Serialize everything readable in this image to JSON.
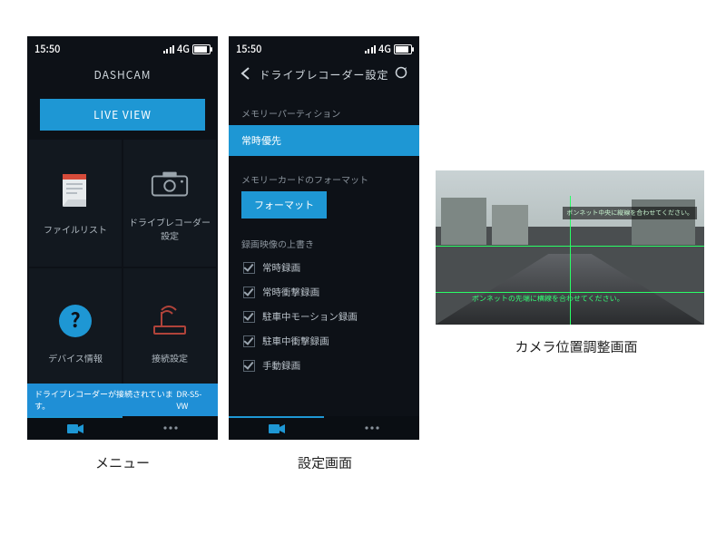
{
  "status": {
    "time": "15:50",
    "network": "4G"
  },
  "menu": {
    "title": "DASHCAM",
    "live_view": "LIVE VIEW",
    "tiles": {
      "file_list": "ファイルリスト",
      "recorder_settings": "ドライブレコーダー\n設定",
      "device_info": "デバイス情報",
      "connection_settings": "接続設定"
    },
    "status_bar": {
      "message": "ドライブレコーダーが接続されています。",
      "model": "DR-S5-VW"
    }
  },
  "settings": {
    "title": "ドライブレコーダー設定",
    "sections": {
      "memory_partition": {
        "label": "メモリーパーティション",
        "value": "常時優先"
      },
      "memory_format": {
        "label": "メモリーカードのフォーマット",
        "button": "フォーマット"
      },
      "overwrite": {
        "label": "録画映像の上書き",
        "options": [
          "常時録画",
          "常時衝撃録画",
          "駐車中モーション録画",
          "駐車中衝撃録画",
          "手動録画"
        ]
      }
    }
  },
  "preview": {
    "hint_top": "ボンネット中央に縦線を合わせてください。",
    "hint_bottom": "ボンネットの先端に横線を合わせてください。"
  },
  "captions": {
    "menu": "メニュー",
    "settings": "設定画面",
    "preview": "カメラ位置調整画面"
  }
}
